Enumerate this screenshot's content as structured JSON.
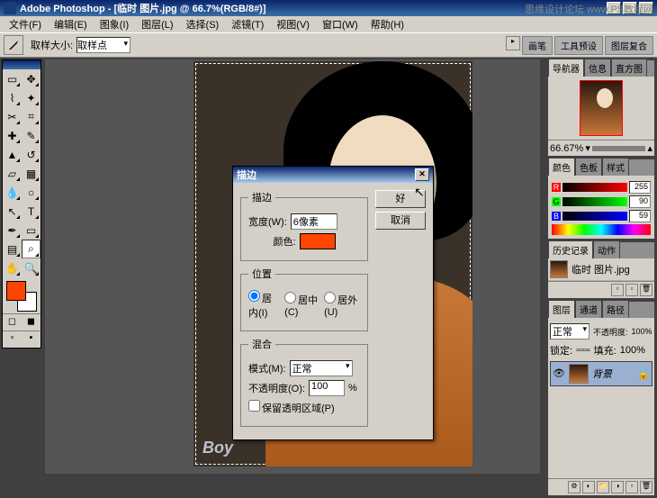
{
  "app": {
    "title": "Adobe Photoshop - [临时 图片.jpg @ 66.7%(RGB/8#)]",
    "watermark_tr": "思缘设计论坛  www.PS教程网",
    "canvas_wm": "Boy"
  },
  "menu": {
    "file": "文件(F)",
    "edit": "编辑(E)",
    "image": "图象(I)",
    "layer": "图层(L)",
    "select": "选择(S)",
    "filter": "滤镜(T)",
    "view": "视图(V)",
    "window": "窗口(W)",
    "help": "帮助(H)"
  },
  "optbar": {
    "label1": "取样大小:",
    "value1": "取样点",
    "tab1": "画笔",
    "tab2": "工具预设",
    "tab3": "图层复合"
  },
  "dialog": {
    "title": "描边",
    "ok": "好",
    "cancel": "取消",
    "grp_stroke": "描边",
    "width_lbl": "宽度(W):",
    "width_val": "6像素",
    "color_lbl": "颜色:",
    "grp_pos": "位置",
    "pos_inside": "居内(I)",
    "pos_center": "居中(C)",
    "pos_outside": "居外(U)",
    "grp_blend": "混合",
    "mode_lbl": "模式(M):",
    "mode_val": "正常",
    "opacity_lbl": "不透明度(O):",
    "opacity_val": "100",
    "opacity_pct": "%",
    "preserve": "保留透明区域(P)"
  },
  "panels": {
    "nav": {
      "t1": "导航器",
      "t2": "信息",
      "t3": "直方图",
      "zoom": "66.67%"
    },
    "color": {
      "t1": "颜色",
      "t2": "色板",
      "t3": "样式",
      "r": "255",
      "g": "90",
      "b": "59"
    },
    "history": {
      "t1": "历史记录",
      "t2": "动作",
      "item": "临时 图片.jpg"
    },
    "layers": {
      "t1": "图层",
      "t2": "通道",
      "t3": "路径",
      "mode": "正常",
      "opacity_lbl": "不透明度:",
      "opacity": "100%",
      "lock_lbl": "锁定:",
      "fill_lbl": "填充:",
      "fill": "100%",
      "bg_layer": "背景"
    }
  },
  "colors": {
    "fg": "#ff4500",
    "bg": "#ffffff"
  }
}
